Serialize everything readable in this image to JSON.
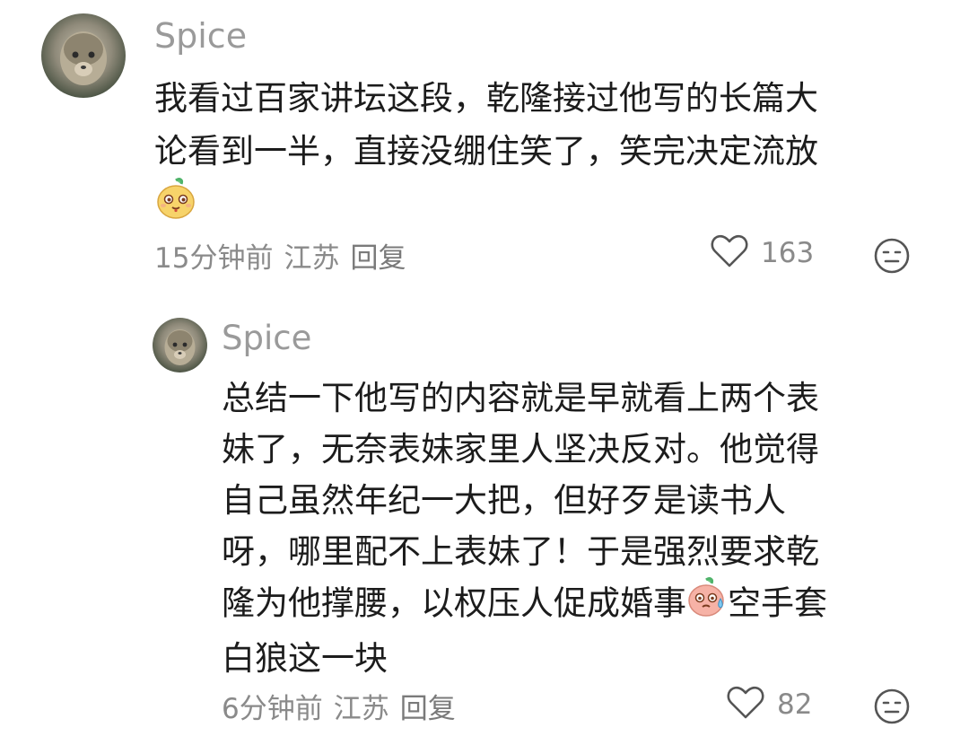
{
  "comments": [
    {
      "username": "Spice",
      "text_lines": [
        "我看过百家讲坛这段，乾隆接过他写的长篇大",
        "论看到一半，直接没绷住笑了，笑完决定流放"
      ],
      "trailing_emoji": "smug-face-emoji",
      "time": "15分钟前",
      "location": "江苏",
      "reply_label": "回复",
      "like_count": "163"
    },
    {
      "username": "Spice",
      "text_lines": [
        "总结一下他写的内容就是早就看上两个表",
        "妹了，无奈表妹家里人坚决反对。他觉得",
        "自己虽然年纪一大把，但好歹是读书人",
        "呀，哪里配不上表妹了！于是强烈要求乾",
        "隆为他撑腰，以权压人促成婚事",
        "空手套",
        "白狼这一块"
      ],
      "inline_emoji": "sweat-face-emoji",
      "time": "6分钟前",
      "location": "江苏",
      "reply_label": "回复",
      "like_count": "82"
    }
  ],
  "icons": {
    "like": "heart-outline-icon",
    "dislike": "meh-face-icon"
  },
  "colors": {
    "meta_text": "#8a8a8a",
    "username": "#9a9a9a",
    "body_text": "#1c1c1c",
    "emoji_yellow": "#f7d36a",
    "emoji_pink": "#f6b2a6"
  }
}
